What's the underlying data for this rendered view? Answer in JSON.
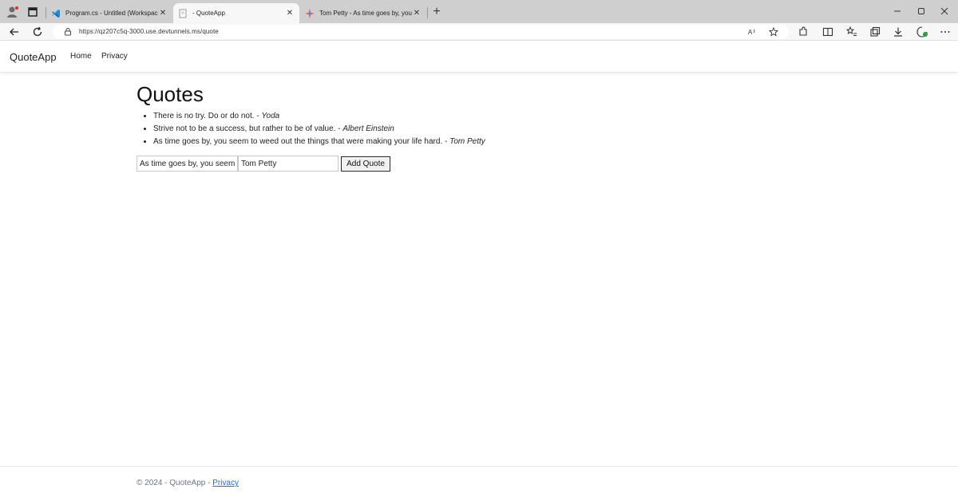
{
  "browser": {
    "tabs": [
      {
        "title": "Program.cs - Untitled (Workspace)",
        "icon": "vscode-icon",
        "active": false
      },
      {
        "title": "- QuoteApp",
        "icon": "page-icon",
        "active": true
      },
      {
        "title": "Tom Petty - As time goes by, you",
        "icon": "sparkle-icon",
        "active": false
      }
    ],
    "new_tab": "+",
    "url": "https://qz207c5q-3000.use.devtunnels.ms/quote"
  },
  "navbar": {
    "brand": "QuoteApp",
    "links": [
      "Home",
      "Privacy"
    ]
  },
  "main": {
    "heading": "Quotes",
    "quotes": [
      {
        "text": "There is no try. Do or do not. - ",
        "author": "Yoda"
      },
      {
        "text": "Strive not to be a success, but rather to be of value. - ",
        "author": "Albert Einstein"
      },
      {
        "text": "As time goes by, you seem to weed out the things that were making your life hard. - ",
        "author": "Tom Petty"
      }
    ],
    "form": {
      "quote_value": "As time goes by, you seem to weed out the things that were making your life hard.",
      "author_value": "Tom Petty",
      "submit_label": "Add Quote"
    }
  },
  "footer": {
    "text": "© 2024 - QuoteApp - ",
    "link": "Privacy"
  }
}
